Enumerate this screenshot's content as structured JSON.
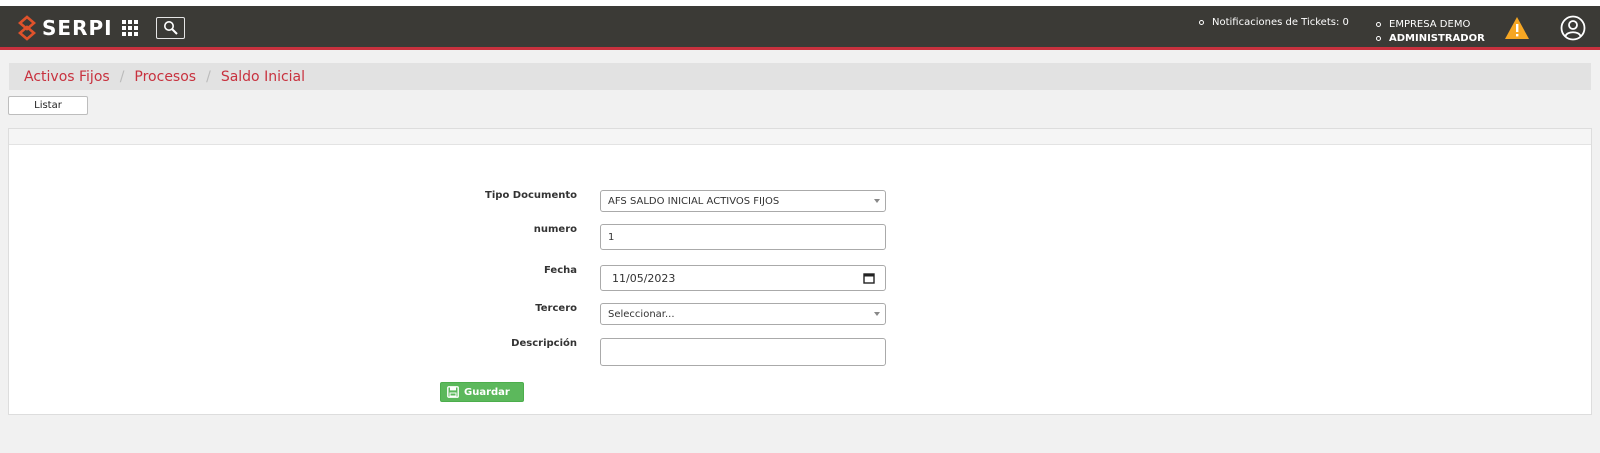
{
  "header": {
    "logo_text": "SERPI",
    "notifications_label": "Notificaciones de Tickets: 0",
    "company": "EMPRESA DEMO",
    "role": "ADMINISTRADOR",
    "bar_color": "#3b3a36",
    "accent_color": "#c8313e",
    "icons": [
      "apps-grid-icon",
      "search-icon",
      "warning-icon",
      "user-icon"
    ]
  },
  "breadcrumb": {
    "items": [
      "Activos Fijos",
      "Procesos",
      "Saldo Inicial"
    ],
    "separator": "/"
  },
  "toolbar": {
    "list_label": "Listar"
  },
  "form": {
    "tipo_documento": {
      "label": "Tipo Documento",
      "value": "AFS SALDO INICIAL ACTIVOS FIJOS"
    },
    "numero": {
      "label": "numero",
      "value": "1"
    },
    "fecha": {
      "label": "Fecha",
      "value": "11/05/2023"
    },
    "tercero": {
      "label": "Tercero",
      "value": "Seleccionar..."
    },
    "descripcion": {
      "label": "Descripción",
      "value": ""
    },
    "save_label": "Guardar",
    "save_color": "#5cb85c"
  }
}
